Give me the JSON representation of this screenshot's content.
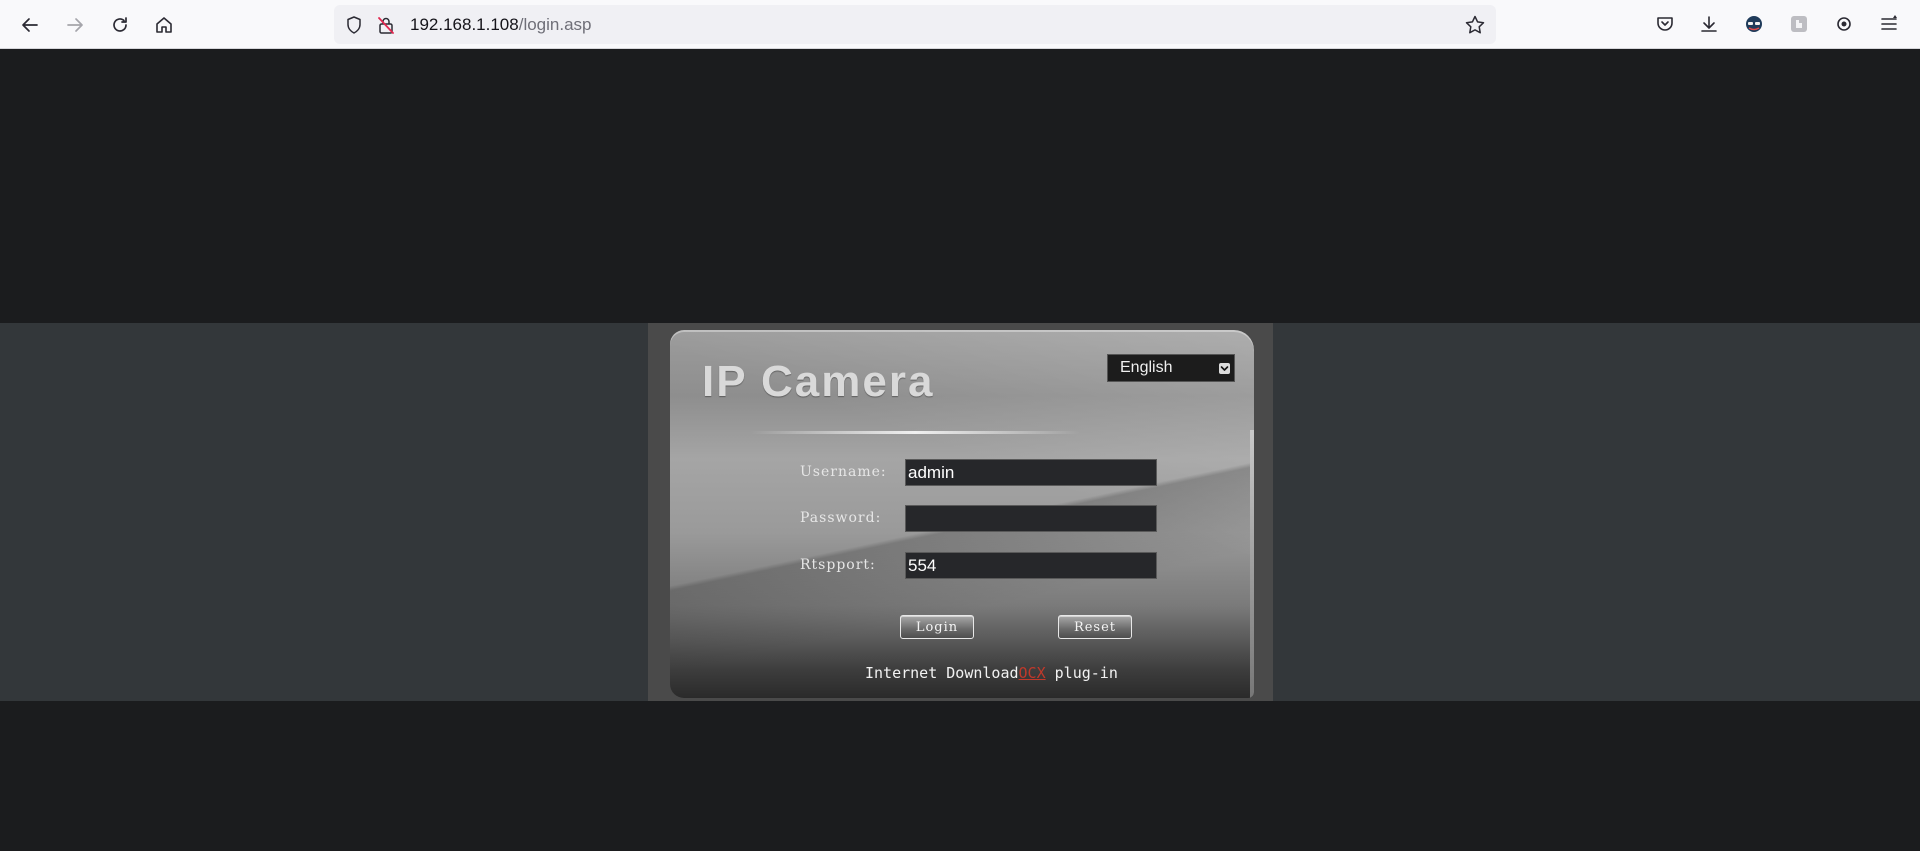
{
  "browser": {
    "url_host": "192.168.1.108",
    "url_path": "/login.asp"
  },
  "page": {
    "brand_title": "IP Camera",
    "language": {
      "selected": "English"
    },
    "form": {
      "username_label": "Username:",
      "username_value": "admin",
      "password_label": "Password:",
      "password_value": "",
      "rtspport_label": "Rtspport:",
      "rtspport_value": "554",
      "login_button": "Login",
      "reset_button": "Reset"
    },
    "download": {
      "prefix": "Internet Download",
      "link": "OCX",
      "suffix": " plug-in"
    }
  },
  "colors": {
    "page_background": "#1b1c1e",
    "band": "#33373a",
    "link": "#c0392b"
  }
}
